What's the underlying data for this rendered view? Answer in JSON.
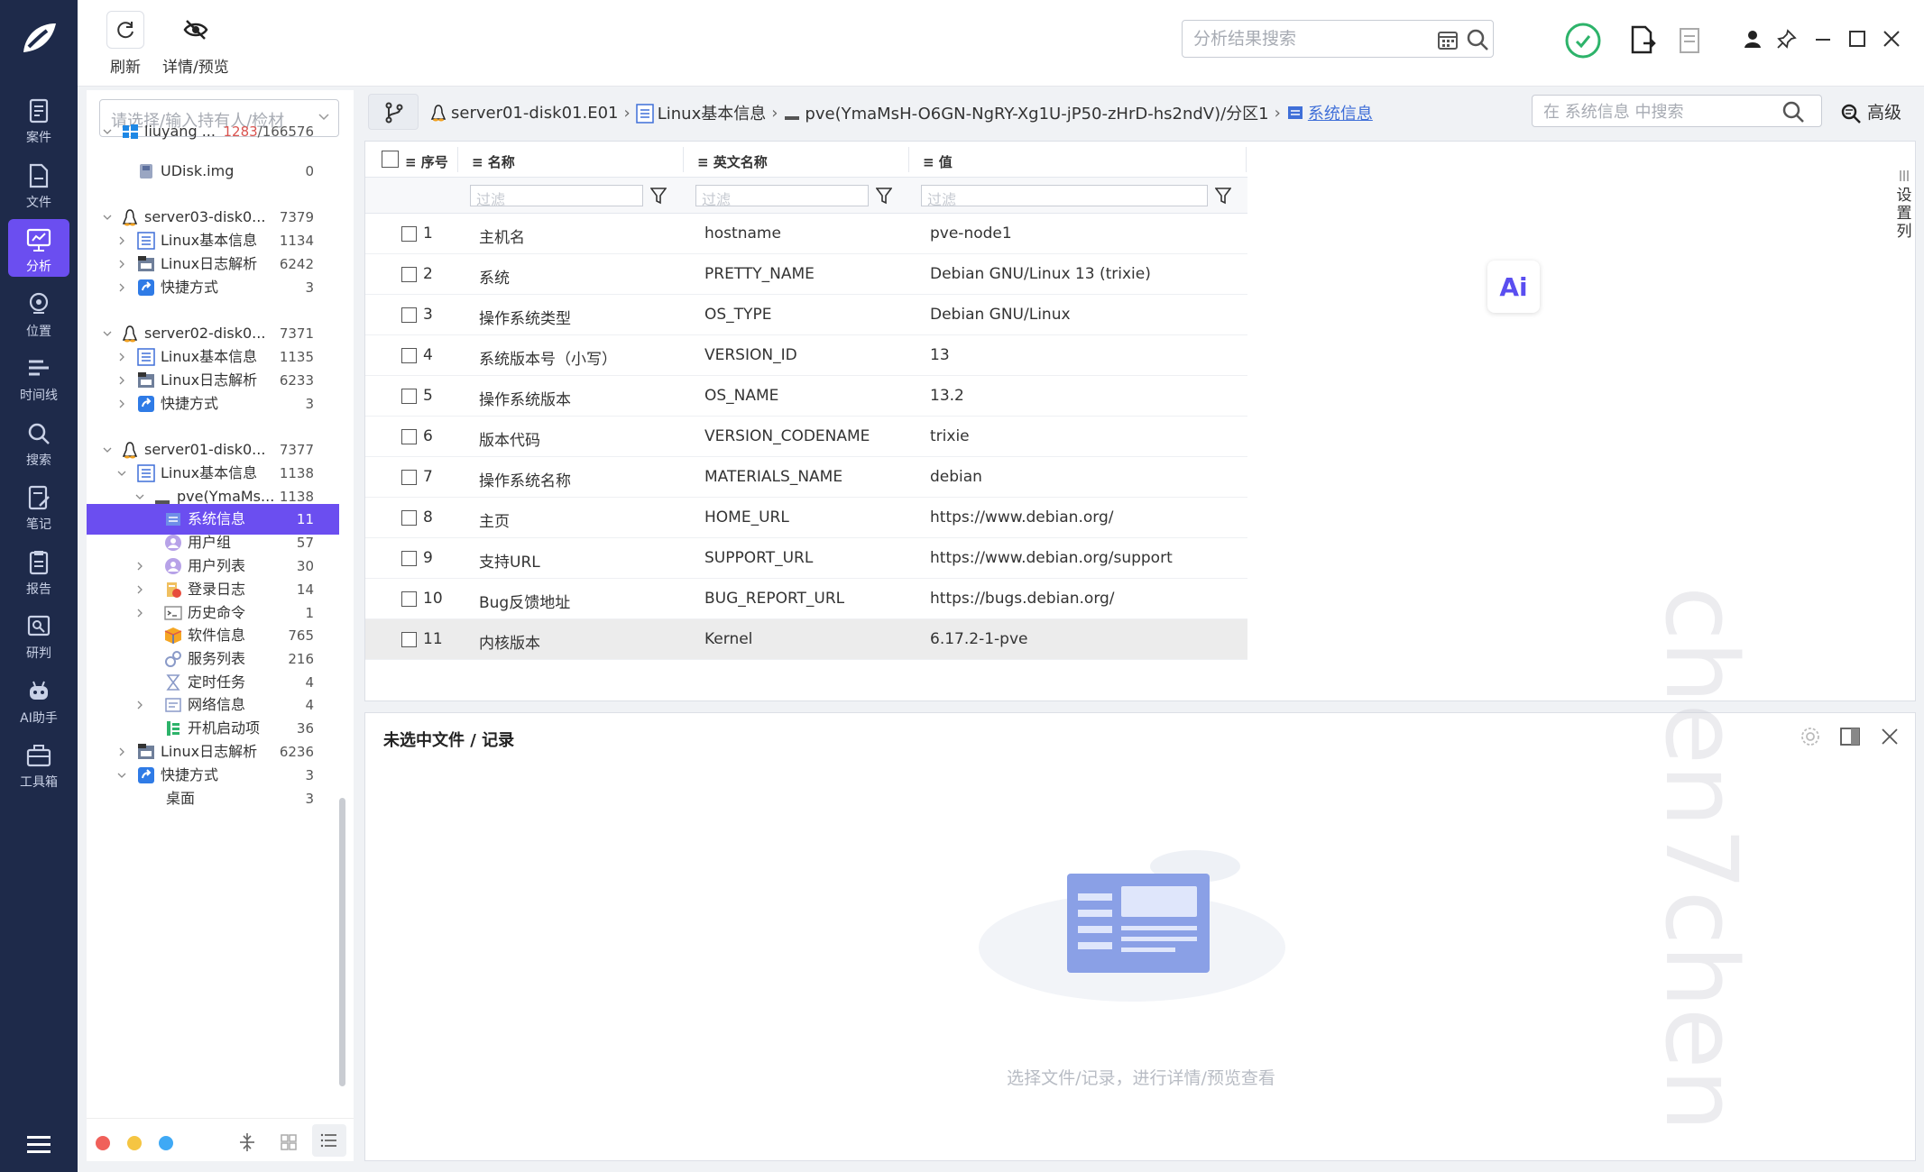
{
  "nav": {
    "items": [
      {
        "label": "案件",
        "icon": "case-icon"
      },
      {
        "label": "文件",
        "icon": "file-icon"
      },
      {
        "label": "分析",
        "icon": "analysis-icon",
        "active": true
      },
      {
        "label": "位置",
        "icon": "location-icon"
      },
      {
        "label": "时间线",
        "icon": "timeline-icon"
      },
      {
        "label": "搜索",
        "icon": "search-icon"
      },
      {
        "label": "笔记",
        "icon": "note-icon"
      },
      {
        "label": "报告",
        "icon": "report-icon"
      },
      {
        "label": "研判",
        "icon": "judge-icon"
      },
      {
        "label": "AI助手",
        "icon": "ai-assistant-icon"
      },
      {
        "label": "工具箱",
        "icon": "toolbox-icon"
      }
    ]
  },
  "toolbar": {
    "refresh_label": "刷新",
    "preview_label": "详情/预览",
    "search_placeholder": "分析结果搜索"
  },
  "sidebar": {
    "owner_placeholder": "请选择/输入持有人/检材",
    "tree": [
      {
        "name": "liuyang ...",
        "count_red": "1283",
        "count": "/166576",
        "level": 0,
        "icon": "windows-icon",
        "expanded": true
      },
      {
        "name": "UDisk.img",
        "count": "0",
        "level": 1,
        "icon": "disk-icon"
      },
      {
        "name": "server03-disk0...",
        "count": "7379",
        "level": 0,
        "icon": "linux-icon",
        "expanded": true
      },
      {
        "name": "Linux基本信息",
        "count": "1134",
        "level": 1,
        "icon": "list-icon"
      },
      {
        "name": "Linux日志解析",
        "count": "6242",
        "level": 1,
        "icon": "log-icon"
      },
      {
        "name": "快捷方式",
        "count": "3",
        "level": 1,
        "icon": "shortcut-icon"
      },
      {
        "name": "server02-disk0...",
        "count": "7371",
        "level": 0,
        "icon": "linux-icon",
        "expanded": true
      },
      {
        "name": "Linux基本信息",
        "count": "1135",
        "level": 1,
        "icon": "list-icon"
      },
      {
        "name": "Linux日志解析",
        "count": "6233",
        "level": 1,
        "icon": "log-icon"
      },
      {
        "name": "快捷方式",
        "count": "3",
        "level": 1,
        "icon": "shortcut-icon"
      },
      {
        "name": "server01-disk0...",
        "count": "7377",
        "level": 0,
        "icon": "linux-icon",
        "expanded": true
      },
      {
        "name": "Linux基本信息",
        "count": "1138",
        "level": 1,
        "icon": "list-icon",
        "expanded": true
      },
      {
        "name": "pve(YmaMs...",
        "count": "1138",
        "level": 2,
        "icon": "partition-icon",
        "expanded": true
      },
      {
        "name": "系统信息",
        "count": "11",
        "level": 3,
        "icon": "sysinfo-icon",
        "selected": true
      },
      {
        "name": "用户组",
        "count": "57",
        "level": 3,
        "icon": "usergroup-icon"
      },
      {
        "name": "用户列表",
        "count": "30",
        "level": 3,
        "icon": "userlist-icon"
      },
      {
        "name": "登录日志",
        "count": "14",
        "level": 3,
        "icon": "login-log-icon"
      },
      {
        "name": "历史命令",
        "count": "1",
        "level": 3,
        "icon": "terminal-icon"
      },
      {
        "name": "软件信息",
        "count": "765",
        "level": 3,
        "icon": "package-icon"
      },
      {
        "name": "服务列表",
        "count": "216",
        "level": 3,
        "icon": "service-icon"
      },
      {
        "name": "定时任务",
        "count": "4",
        "level": 3,
        "icon": "hourglass-icon"
      },
      {
        "name": "网络信息",
        "count": "4",
        "level": 3,
        "icon": "network-icon"
      },
      {
        "name": "开机启动项",
        "count": "36",
        "level": 3,
        "icon": "startup-icon"
      },
      {
        "name": "Linux日志解析",
        "count": "6236",
        "level": 1,
        "icon": "log-icon"
      },
      {
        "name": "快捷方式",
        "count": "3",
        "level": 1,
        "icon": "shortcut-icon",
        "expanded": true
      },
      {
        "name": "桌面",
        "count": "3",
        "level": 2,
        "icon": ""
      }
    ]
  },
  "breadcrumb": {
    "items": [
      "server01-disk01.E01",
      "Linux基本信息",
      "pve(YmaMsH-O6GN-NgRY-Xg1U-jP50-zHrD-hs2ndV)/分区1",
      "系统信息"
    ],
    "search_placeholder": "在 系统信息 中搜索",
    "advanced_label": "高级"
  },
  "table": {
    "headers": {
      "index": "序号",
      "name": "名称",
      "en_name": "英文名称",
      "value": "值"
    },
    "filter_placeholder": "过滤",
    "rows": [
      {
        "idx": "1",
        "name": "主机名",
        "en": "hostname",
        "value": "pve-node1"
      },
      {
        "idx": "2",
        "name": "系统",
        "en": "PRETTY_NAME",
        "value": "Debian GNU/Linux 13 (trixie)"
      },
      {
        "idx": "3",
        "name": "操作系统类型",
        "en": "OS_TYPE",
        "value": "Debian GNU/Linux"
      },
      {
        "idx": "4",
        "name": "系统版本号（小写）",
        "en": "VERSION_ID",
        "value": "13"
      },
      {
        "idx": "5",
        "name": "操作系统版本",
        "en": "OS_NAME",
        "value": "13.2"
      },
      {
        "idx": "6",
        "name": "版本代码",
        "en": "VERSION_CODENAME",
        "value": "trixie"
      },
      {
        "idx": "7",
        "name": "操作系统名称",
        "en": "MATERIALS_NAME",
        "value": "debian"
      },
      {
        "idx": "8",
        "name": "主页",
        "en": "HOME_URL",
        "value": "https://www.debian.org/"
      },
      {
        "idx": "9",
        "name": "支持URL",
        "en": "SUPPORT_URL",
        "value": "https://www.debian.org/support"
      },
      {
        "idx": "10",
        "name": "Bug反馈地址",
        "en": "BUG_REPORT_URL",
        "value": "https://bugs.debian.org/"
      },
      {
        "idx": "11",
        "name": "内核版本",
        "en": "Kernel",
        "value": "6.17.2-1-pve",
        "selected": true
      }
    ],
    "settings_column_label": "设置列"
  },
  "ai_button": "Ai",
  "detail": {
    "title": "未选中文件 / 记录",
    "empty_text": "选择文件/记录，进行详情/预览查看"
  },
  "watermark": "chen7chen",
  "colors": {
    "accent": "#6b4ef0",
    "nav_bg": "#1e2a4a",
    "link": "#3f6fd8"
  }
}
